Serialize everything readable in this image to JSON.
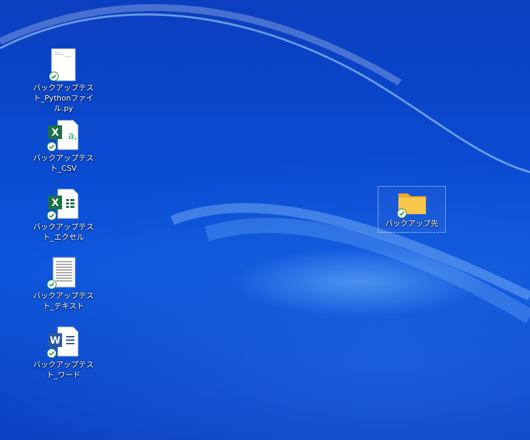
{
  "desktop": {
    "icons": [
      {
        "label": "バックアップテスト_Pythonファイル.py",
        "type": "python-file"
      },
      {
        "label": "バックアップテスト_CSV",
        "type": "csv-file"
      },
      {
        "label": "バックアップテスト_エクセル",
        "type": "excel-file"
      },
      {
        "label": "バックアップテスト_テキスト",
        "type": "text-file"
      },
      {
        "label": "バックアップテスト_ワード",
        "type": "word-file"
      },
      {
        "label": "バックアップ先",
        "type": "folder"
      }
    ],
    "sync_status_icon": "green-check-icon",
    "colors": {
      "excel": "#1e7145",
      "word": "#2b579a",
      "folder": "#f5c242",
      "check": "#1f8a3a"
    }
  }
}
